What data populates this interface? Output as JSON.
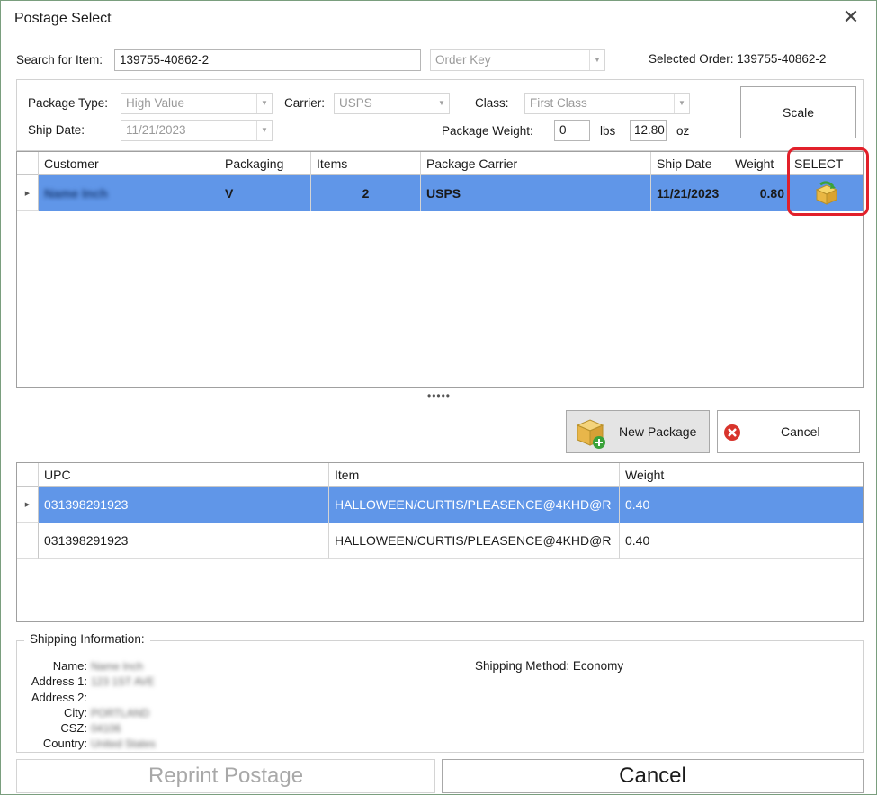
{
  "window": {
    "title": "Postage Select",
    "close_glyph": "✕"
  },
  "search": {
    "label": "Search for Item:",
    "value": "139755-40862-2",
    "key_combo": "Order Key",
    "selected_order": "Selected Order: 139755-40862-2"
  },
  "package": {
    "type_label": "Package Type:",
    "type_value": "High Value",
    "carrier_label": "Carrier:",
    "carrier_value": "USPS",
    "class_label": "Class:",
    "class_value": "First Class",
    "ship_date_label": "Ship Date:",
    "ship_date_value": "11/21/2023",
    "weight_label": "Package Weight:",
    "lbs_value": "0",
    "lbs_unit": "lbs",
    "oz_value": "12.80",
    "oz_unit": "oz",
    "scale_button": "Scale"
  },
  "orders_grid": {
    "columns": [
      "Customer",
      "Packaging",
      "Items",
      "Package Carrier",
      "Ship Date",
      "Weight",
      "SELECT"
    ],
    "rows": [
      {
        "customer": "Name Inch",
        "packaging": "V",
        "items": "2",
        "carrier": "USPS",
        "ship_date": "11/21/2023",
        "weight": "0.80",
        "select_icon": "package-select-icon"
      }
    ],
    "row_indicator": "▶"
  },
  "splitter": "•••••",
  "actions": {
    "new_package": "New Package",
    "cancel": "Cancel"
  },
  "items_grid": {
    "columns": [
      "UPC",
      "Item",
      "Weight"
    ],
    "rows": [
      {
        "upc": "031398291923",
        "item": "HALLOWEEN/CURTIS/PLEASENCE@4KHD@R",
        "weight": "0.40"
      },
      {
        "upc": "031398291923",
        "item": "HALLOWEEN/CURTIS/PLEASENCE@4KHD@R",
        "weight": "0.40"
      }
    ],
    "row_indicator": "▶"
  },
  "shipping": {
    "legend": "Shipping Information:",
    "name_label": "Name:",
    "name_value": "Name Inch",
    "address1_label": "Address 1:",
    "address1_value": "123 1ST AVE",
    "address2_label": "Address 2:",
    "address2_value": "",
    "city_label": "City:",
    "city_value": "PORTLAND",
    "csz_label": "CSZ:",
    "csz_value": "04106",
    "country_label": "Country:",
    "country_value": "United States",
    "method": "Shipping Method: Economy"
  },
  "footer": {
    "reprint": "Reprint Postage",
    "cancel": "Cancel"
  },
  "colors": {
    "selection": "#6096e8",
    "highlight": "#e2202a",
    "cancel_icon": "#d8342c"
  }
}
